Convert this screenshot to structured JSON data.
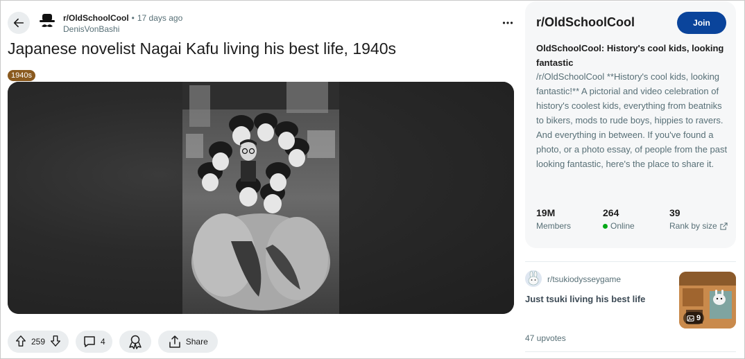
{
  "post": {
    "subreddit": "r/OldSchoolCool",
    "separator": "•",
    "age": "17 days ago",
    "author": "DenisVonBashi",
    "title": "Japanese novelist Nagai Kafu living his best life, 1940s",
    "flair": "1940s",
    "actions": {
      "upvotes": "259",
      "comments": "4",
      "share_label": "Share"
    }
  },
  "icons": {
    "back": "arrow-left-icon",
    "more": "ellipsis-icon",
    "upvote": "arrow-up-icon",
    "downvote": "arrow-down-icon",
    "comment": "speech-bubble-icon",
    "award": "award-icon",
    "share": "share-icon",
    "external": "external-link-icon",
    "gallery": "gallery-icon"
  },
  "sidebar": {
    "title": "r/OldSchoolCool",
    "join_label": "Join",
    "headline": "OldSchoolCool: History's cool kids, looking fantastic",
    "description": "/r/OldSchoolCool **History's cool kids, looking fantastic!** A pictorial and video celebration of history's coolest kids, everything from beatniks to bikers, mods to rude boys, hippies to ravers. And everything in between. If you've found a photo, or a photo essay, of people from the past looking fantastic, here's the place to share it.",
    "stats": {
      "members_value": "19M",
      "members_label": "Members",
      "online_value": "264",
      "online_label": "Online",
      "rank_value": "39",
      "rank_label": "Rank by size"
    }
  },
  "recommended": {
    "subreddit": "r/tsukiodysseygame",
    "title": "Just tsuki living his best life",
    "image_count": "9",
    "upvotes": "47 upvotes"
  },
  "colors": {
    "join_button": "#0a449b",
    "flair_bg": "#8a5a1f",
    "online_dot": "#01a816",
    "pill_bg": "#eaedef",
    "sidebar_bg": "#f6f7f8"
  }
}
